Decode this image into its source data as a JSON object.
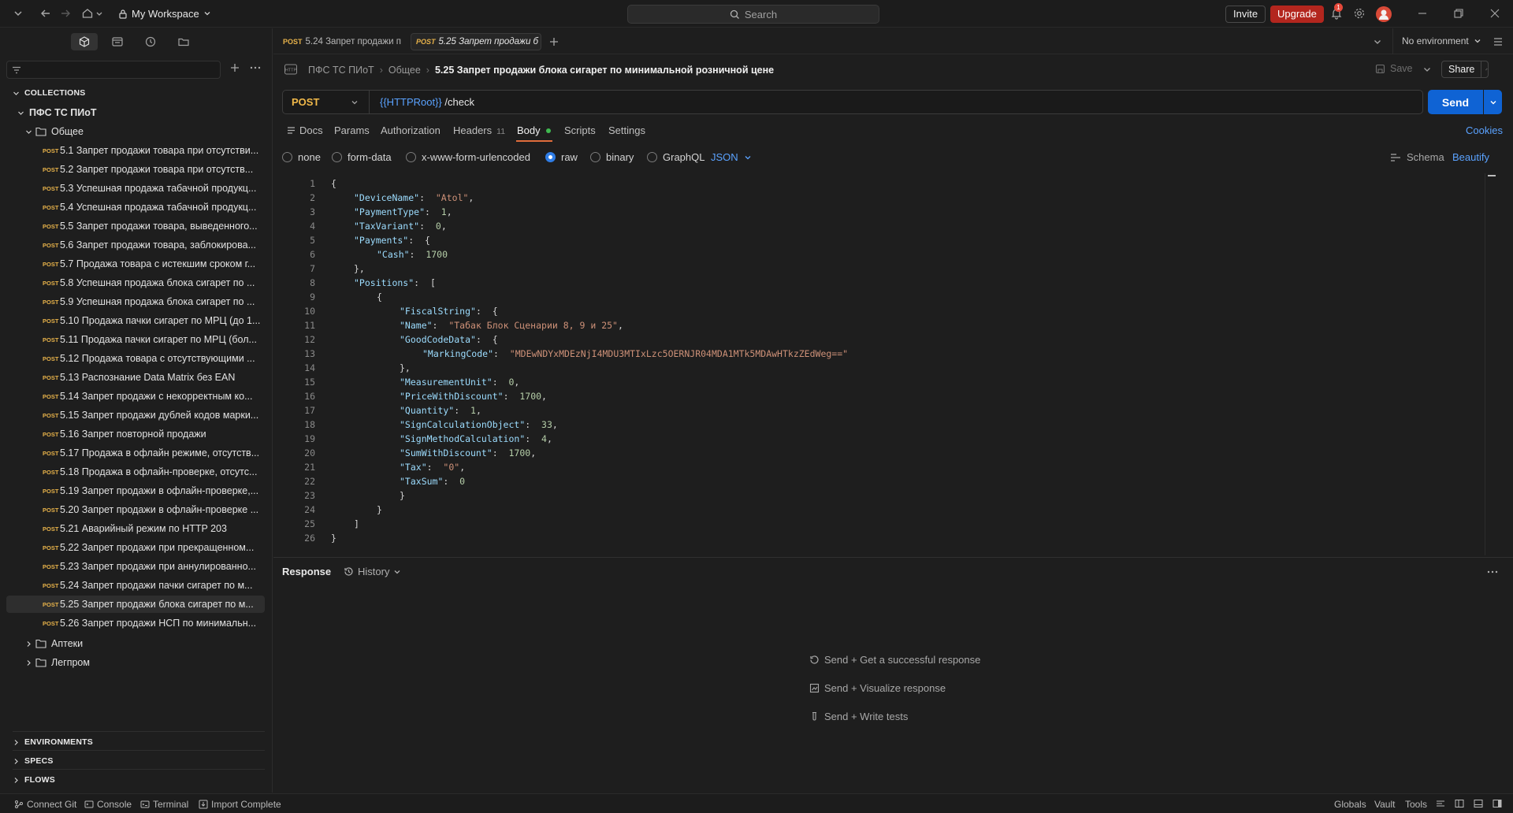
{
  "titlebar": {
    "workspace": "My Workspace",
    "search_placeholder": "Search",
    "invite": "Invite",
    "upgrade": "Upgrade",
    "notifications_count": "1"
  },
  "sidebar": {
    "collections_label": "COLLECTIONS",
    "collection_name": "ПФС ТС ПИоТ",
    "folder_name": "Общее",
    "method": "POST",
    "requests": [
      "5.1 Запрет продажи товара при отсутстви...",
      "5.2 Запрет продажи товара при отсутств...",
      "5.3 Успешная продажа табачной продукц...",
      "5.4 Успешная продажа табачной продукц...",
      "5.5 Запрет продажи товара, выведенного...",
      "5.6 Запрет продажи товара, заблокирова...",
      "5.7 Продажа товара с истекшим сроком г...",
      "5.8 Успешная продажа блока сигарет по ...",
      "5.9 Успешная продажа блока сигарет по ...",
      "5.10 Продажа пачки сигарет по МРЦ (до 1...",
      "5.11 Продажа пачки сигарет по МРЦ (бол...",
      "5.12 Продажа товара с отсутствующими ...",
      "5.13 Распознание Data Matrix без EAN",
      "5.14 Запрет продажи с некорректным ко...",
      "5.15 Запрет продажи дублей кодов марки...",
      "5.16 Запрет повторной продажи",
      "5.17 Продажа в офлайн режиме, отсутств...",
      "5.18 Продажа в офлайн-проверке, отсутс...",
      "5.19 Запрет продажи в офлайн-проверке,...",
      "5.20 Запрет продажи в офлайн-проверке ...",
      "5.21 Аварийный режим по HTTP 203",
      "5.22 Запрет продажи при прекращенном...",
      "5.23 Запрет продажи при аннулированно...",
      "5.24 Запрет продажи пачки сигарет по м...",
      "5.25 Запрет продажи блока сигарет по м...",
      "5.26 Запрет продажи НСП по минимальн..."
    ],
    "other_folders": [
      "Аптеки",
      "Легпром"
    ],
    "environments_label": "ENVIRONMENTS",
    "specs_label": "SPECS",
    "flows_label": "FLOWS"
  },
  "tabs": {
    "method": "POST",
    "tab1": "5.24 Запрет продажи п",
    "tab2": "5.25 Запрет продажи б",
    "environment": "No environment"
  },
  "breadcrumb": {
    "collection": "ПФС ТС ПИоТ",
    "folder": "Общее",
    "request": "5.25 Запрет продажи блока сигарет по минимальной розничной цене",
    "save": "Save",
    "share": "Share"
  },
  "request": {
    "method": "POST",
    "url_var": "{{HTTPRoot}}",
    "url_path": " /check",
    "send": "Send"
  },
  "subtabs": {
    "docs": "Docs",
    "params": "Params",
    "authorization": "Authorization",
    "headers": "Headers",
    "headers_count": "11",
    "body": "Body",
    "scripts": "Scripts",
    "settings": "Settings",
    "cookies": "Cookies"
  },
  "body_types": {
    "none": "none",
    "form_data": "form-data",
    "urlencoded": "x-www-form-urlencoded",
    "raw": "raw",
    "binary": "binary",
    "graphql": "GraphQL",
    "format": "JSON",
    "schema": "Schema",
    "beautify": "Beautify"
  },
  "code_lines": [
    {
      "n": "1",
      "i": 0,
      "t": [
        [
          "p",
          "{"
        ]
      ]
    },
    {
      "n": "2",
      "i": 1,
      "t": [
        [
          "k",
          "\"DeviceName\""
        ],
        [
          "p",
          ":  "
        ],
        [
          "s",
          "\"Atol\""
        ],
        [
          "p",
          ","
        ]
      ]
    },
    {
      "n": "3",
      "i": 1,
      "t": [
        [
          "k",
          "\"PaymentType\""
        ],
        [
          "p",
          ":  "
        ],
        [
          "n",
          "1"
        ],
        [
          "p",
          ","
        ]
      ]
    },
    {
      "n": "4",
      "i": 1,
      "t": [
        [
          "k",
          "\"TaxVariant\""
        ],
        [
          "p",
          ":  "
        ],
        [
          "n",
          "0"
        ],
        [
          "p",
          ","
        ]
      ]
    },
    {
      "n": "5",
      "i": 1,
      "t": [
        [
          "k",
          "\"Payments\""
        ],
        [
          "p",
          ":  {"
        ]
      ]
    },
    {
      "n": "6",
      "i": 2,
      "t": [
        [
          "k",
          "\"Cash\""
        ],
        [
          "p",
          ":  "
        ],
        [
          "n",
          "1700"
        ]
      ]
    },
    {
      "n": "7",
      "i": 1,
      "t": [
        [
          "p",
          "},"
        ]
      ]
    },
    {
      "n": "8",
      "i": 1,
      "t": [
        [
          "k",
          "\"Positions\""
        ],
        [
          "p",
          ":  ["
        ]
      ]
    },
    {
      "n": "9",
      "i": 2,
      "t": [
        [
          "p",
          "{"
        ]
      ]
    },
    {
      "n": "10",
      "i": 3,
      "t": [
        [
          "k",
          "\"FiscalString\""
        ],
        [
          "p",
          ":  {"
        ]
      ]
    },
    {
      "n": "11",
      "i": 3,
      "t": [
        [
          "k",
          "\"Name\""
        ],
        [
          "p",
          ":  "
        ],
        [
          "s",
          "\"Табак Блок Сценарии 8, 9 и 25\""
        ],
        [
          "p",
          ","
        ]
      ]
    },
    {
      "n": "12",
      "i": 3,
      "t": [
        [
          "k",
          "\"GoodCodeData\""
        ],
        [
          "p",
          ":  {"
        ]
      ]
    },
    {
      "n": "13",
      "i": 4,
      "t": [
        [
          "k",
          "\"MarkingCode\""
        ],
        [
          "p",
          ":  "
        ],
        [
          "s",
          "\"MDEwNDYxMDEzNjI4MDU3MTIxLzc5OERNJR04MDA1MTk5MDAwHTkzZEdWeg==\""
        ]
      ]
    },
    {
      "n": "14",
      "i": 3,
      "t": [
        [
          "p",
          "},"
        ]
      ]
    },
    {
      "n": "15",
      "i": 3,
      "t": [
        [
          "k",
          "\"MeasurementUnit\""
        ],
        [
          "p",
          ":  "
        ],
        [
          "n",
          "0"
        ],
        [
          "p",
          ","
        ]
      ]
    },
    {
      "n": "16",
      "i": 3,
      "t": [
        [
          "k",
          "\"PriceWithDiscount\""
        ],
        [
          "p",
          ":  "
        ],
        [
          "n",
          "1700"
        ],
        [
          "p",
          ","
        ]
      ]
    },
    {
      "n": "17",
      "i": 3,
      "t": [
        [
          "k",
          "\"Quantity\""
        ],
        [
          "p",
          ":  "
        ],
        [
          "n",
          "1"
        ],
        [
          "p",
          ","
        ]
      ]
    },
    {
      "n": "18",
      "i": 3,
      "t": [
        [
          "k",
          "\"SignCalculationObject\""
        ],
        [
          "p",
          ":  "
        ],
        [
          "n",
          "33"
        ],
        [
          "p",
          ","
        ]
      ]
    },
    {
      "n": "19",
      "i": 3,
      "t": [
        [
          "k",
          "\"SignMethodCalculation\""
        ],
        [
          "p",
          ":  "
        ],
        [
          "n",
          "4"
        ],
        [
          "p",
          ","
        ]
      ]
    },
    {
      "n": "20",
      "i": 3,
      "t": [
        [
          "k",
          "\"SumWithDiscount\""
        ],
        [
          "p",
          ":  "
        ],
        [
          "n",
          "1700"
        ],
        [
          "p",
          ","
        ]
      ]
    },
    {
      "n": "21",
      "i": 3,
      "t": [
        [
          "k",
          "\"Tax\""
        ],
        [
          "p",
          ":  "
        ],
        [
          "s",
          "\"0\""
        ],
        [
          "p",
          ","
        ]
      ]
    },
    {
      "n": "22",
      "i": 3,
      "t": [
        [
          "k",
          "\"TaxSum\""
        ],
        [
          "p",
          ":  "
        ],
        [
          "n",
          "0"
        ]
      ]
    },
    {
      "n": "23",
      "i": 3,
      "t": [
        [
          "p",
          "}"
        ]
      ]
    },
    {
      "n": "24",
      "i": 2,
      "t": [
        [
          "p",
          "}"
        ]
      ]
    },
    {
      "n": "25",
      "i": 1,
      "t": [
        [
          "p",
          "]"
        ]
      ]
    },
    {
      "n": "26",
      "i": 0,
      "t": [
        [
          "p",
          "}"
        ]
      ]
    }
  ],
  "response": {
    "title": "Response",
    "history": "History",
    "hint1": "Send + Get a successful response",
    "hint2": "Send + Visualize response",
    "hint3": "Send + Write tests"
  },
  "statusbar": {
    "connect_git": "Connect Git",
    "console": "Console",
    "terminal": "Terminal",
    "import": "Import Complete",
    "globals": "Globals",
    "vault": "Vault",
    "tools": "Tools"
  }
}
